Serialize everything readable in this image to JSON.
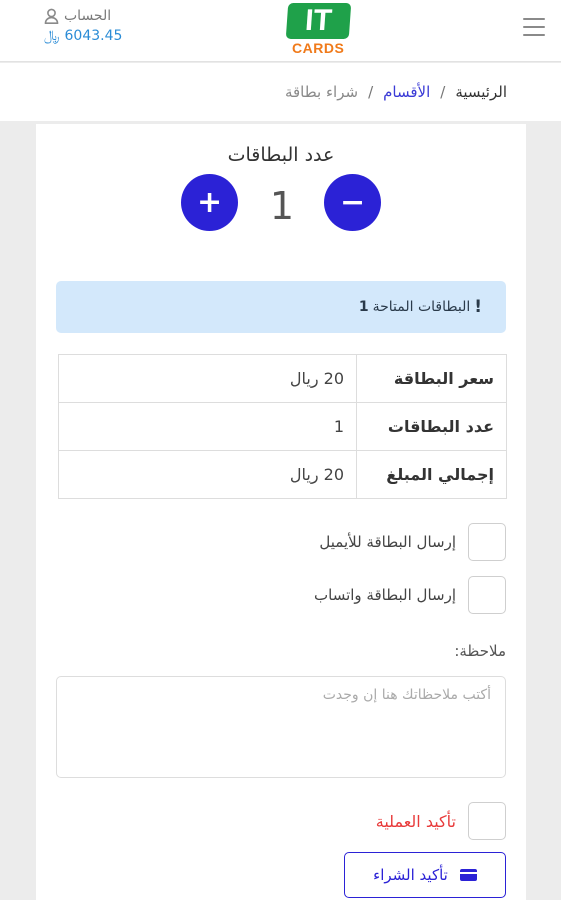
{
  "header": {
    "logo_main": "IT",
    "logo_sub": "CARDS",
    "account_label": "الحساب",
    "balance": "6043.45",
    "currency_symbol": "﷼"
  },
  "breadcrumb": {
    "home": "الرئيسية",
    "sections": "الأقسام",
    "current": "شراء بطاقة",
    "separator": "/"
  },
  "quantity": {
    "title": "عدد البطاقات",
    "value": "1",
    "plus": "+",
    "minus": "−"
  },
  "alert": {
    "text": "البطاقات المتاحة",
    "count": "1",
    "icon": "!"
  },
  "summary": [
    {
      "label": "سعر البطاقة",
      "value": "20 ريال"
    },
    {
      "label": "عدد البطاقات",
      "value": "1"
    },
    {
      "label": "إجمالي المبلغ",
      "value": "20 ريال"
    }
  ],
  "options": {
    "send_email": "إرسال البطاقة للأيميل",
    "send_whatsapp": "إرسال البطاقة واتساب"
  },
  "notes": {
    "label": "ملاحظة:",
    "placeholder": "أكتب ملاحظاتك هنا إن وجدت",
    "value": ""
  },
  "confirm": {
    "checkbox_label": "تأكيد العملية",
    "button_label": "تأكيد الشراء"
  },
  "colors": {
    "primary": "#2b22d6",
    "alert_bg": "#d3e8fb",
    "danger": "#e83a3a",
    "link": "#2b8cd6",
    "brand_green": "#1fa14a",
    "brand_orange": "#f07a1a"
  }
}
